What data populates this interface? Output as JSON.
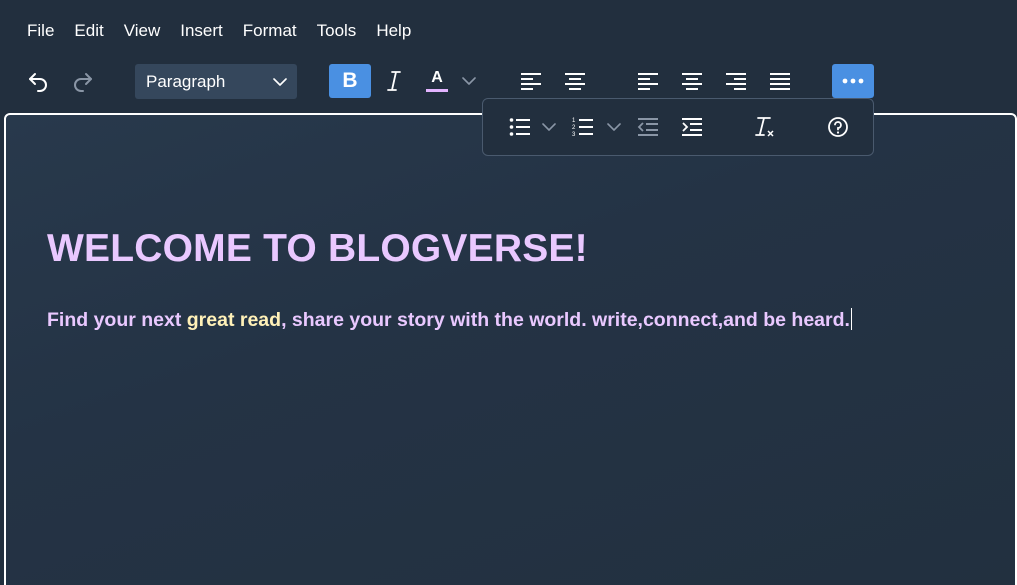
{
  "menubar": {
    "items": [
      "File",
      "Edit",
      "View",
      "Insert",
      "Format",
      "Tools",
      "Help"
    ]
  },
  "toolbar": {
    "block_format": "Paragraph",
    "bold_label": "B",
    "text_color_label": "A",
    "text_color_underline": "#e3b4ff",
    "more_label": "···"
  },
  "overflow": {
    "tools": [
      "bullet-list",
      "numbered-list",
      "outdent",
      "indent",
      "clear-formatting",
      "help"
    ]
  },
  "editor": {
    "heading": "WELCOME TO BLOGVERSE!",
    "para_before": "Find your next ",
    "para_highlight": "great read",
    "para_after": ", share your story with the world. write,connect,and be heard."
  },
  "colors": {
    "background": "#222f3e",
    "accent": "#4a90e2",
    "heading_text": "#e9c8ff",
    "highlight_text": "#fff1b8"
  }
}
